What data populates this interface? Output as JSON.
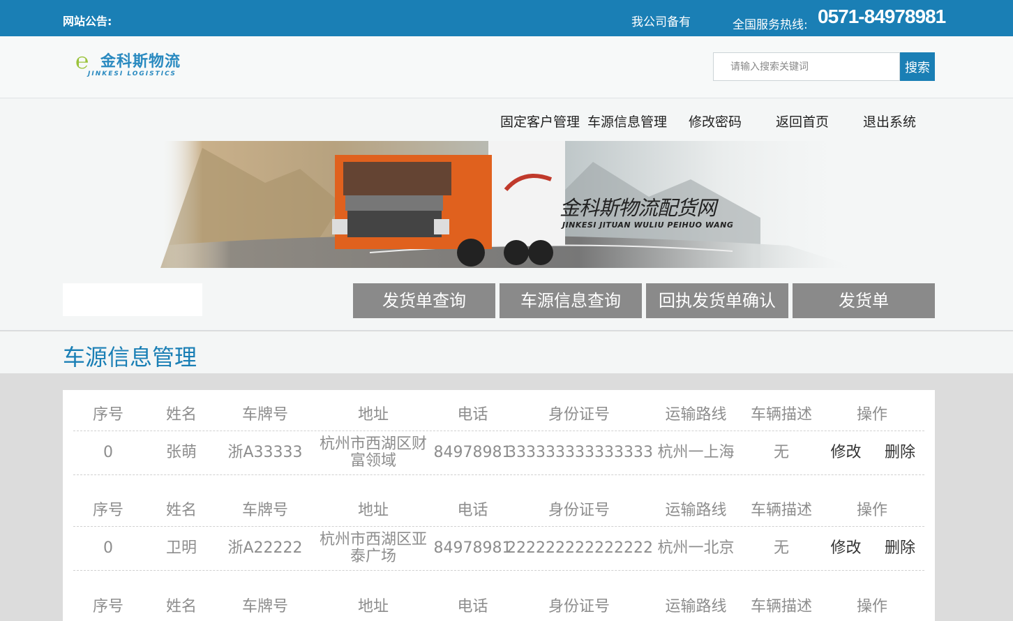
{
  "topbar": {
    "notice_label": "网站公告:",
    "record": "我公司备有",
    "hotline_label": "全国服务热线:",
    "hotline": "0571-84978981"
  },
  "logo": {
    "cn": "金科斯物流",
    "en": "JINKESI LOGISTICS"
  },
  "search": {
    "placeholder": "请输入搜索关键词",
    "button": "搜索"
  },
  "nav": [
    "固定客户管理",
    "车源信息管理",
    "修改密码",
    "返回首页",
    "退出系统"
  ],
  "banner": {
    "title": "金科斯物流配货网",
    "subtitle": "JINKESI JITUAN WULIU PEIHUO WANG"
  },
  "tabs": [
    "发货单查询",
    "车源信息查询",
    "回执发货单确认",
    "发货单"
  ],
  "section_title": "车源信息管理",
  "table": {
    "headers": [
      "序号",
      "姓名",
      "车牌号",
      "地址",
      "电话",
      "身份证号",
      "运输路线",
      "车辆描述",
      "操作"
    ],
    "rows": [
      {
        "id": "0",
        "name": "张萌",
        "plate": "浙A33333",
        "address": "杭州市西湖区财富领域",
        "phone": "84978981",
        "id_card": "333333333333333",
        "route": "杭州一上海",
        "desc": "无",
        "edit": "修改",
        "delete": "删除"
      },
      {
        "id": "0",
        "name": "卫明",
        "plate": "浙A22222",
        "address": "杭州市西湖区亚泰广场",
        "phone": "84978981",
        "id_card": "222222222222222",
        "route": "杭州一北京",
        "desc": "无",
        "edit": "修改",
        "delete": "删除"
      }
    ]
  },
  "colors": {
    "brand_blue": "#1a7fb5",
    "tab_gray": "#8a8a8a",
    "logo_green": "#9bc33b"
  }
}
